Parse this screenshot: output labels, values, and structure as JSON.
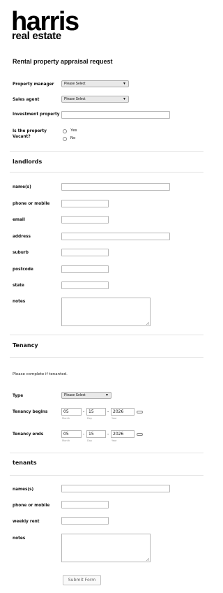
{
  "brand": {
    "name": "harris",
    "tagline": "real estate"
  },
  "form": {
    "title": "Rental property appraisal request",
    "property_manager": {
      "label": "Property manager",
      "value": "Please Select"
    },
    "sales_agent": {
      "label": "Sales agent",
      "value": "Please Select"
    },
    "investment_property": {
      "label": "Investment property",
      "value": ""
    },
    "vacant": {
      "label_line1": "Is the property",
      "label_line2": "Vacant?",
      "options": [
        "Yes",
        "No"
      ]
    }
  },
  "landlords": {
    "title": "landlords",
    "names": {
      "label": "name(s)",
      "value": ""
    },
    "phone": {
      "label": "phone or mobile",
      "value": ""
    },
    "email": {
      "label": "email",
      "value": ""
    },
    "address": {
      "label": "address",
      "value": ""
    },
    "suburb": {
      "label": "suburb",
      "value": ""
    },
    "postcode": {
      "label": "postcode",
      "value": ""
    },
    "state": {
      "label": "state",
      "value": ""
    },
    "notes": {
      "label": "notes",
      "value": ""
    }
  },
  "tenancy": {
    "title": "Tenancy",
    "note": "Please complete if tenanted.",
    "type": {
      "label": "Type",
      "value": "Please Select"
    },
    "begins": {
      "label": "Tenancy begins",
      "month": "05",
      "day": "15",
      "year": "2026"
    },
    "ends": {
      "label": "Tenancy ends",
      "month": "05",
      "day": "15",
      "year": "2026"
    },
    "hints": {
      "month": "Month",
      "day": "Day",
      "year": "Year"
    },
    "separator": "-"
  },
  "tenants": {
    "title": "tenants",
    "names": {
      "label": "names(s)",
      "value": ""
    },
    "phone": {
      "label": "phone or mobile",
      "value": ""
    },
    "rent": {
      "label": "weekly rent",
      "value": ""
    },
    "notes": {
      "label": "notes",
      "value": ""
    }
  },
  "submit_label": "Submit Form"
}
